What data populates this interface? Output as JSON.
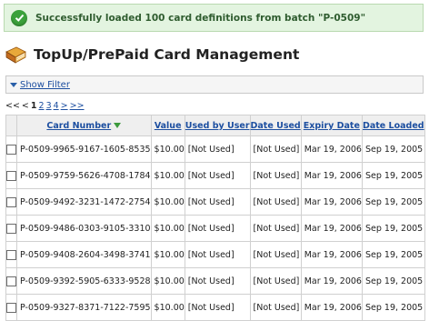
{
  "message": {
    "text": "Successfully loaded 100 card definitions from batch \"P-0509\""
  },
  "page": {
    "title": "TopUp/PrePaid Card Management"
  },
  "filter": {
    "label": "Show Filter"
  },
  "pager": {
    "first": "<<",
    "prev": "<",
    "pages": [
      "1",
      "2",
      "3",
      "4"
    ],
    "current": "1",
    "next": ">",
    "last": ">>"
  },
  "table": {
    "headers": {
      "card_number": "Card Number",
      "value": "Value",
      "used_by": "Used by User",
      "date_used": "Date Used",
      "expiry": "Expiry Date",
      "loaded": "Date Loaded"
    },
    "rows": [
      {
        "card": "P-0509-9965-9167-1605-8535",
        "value": "$10.00",
        "used_by": "[Not Used]",
        "date_used": "[Not Used]",
        "expiry": "Mar 19, 2006",
        "loaded": "Sep 19, 2005"
      },
      {
        "card": "P-0509-9759-5626-4708-1784",
        "value": "$10.00",
        "used_by": "[Not Used]",
        "date_used": "[Not Used]",
        "expiry": "Mar 19, 2006",
        "loaded": "Sep 19, 2005"
      },
      {
        "card": "P-0509-9492-3231-1472-2754",
        "value": "$10.00",
        "used_by": "[Not Used]",
        "date_used": "[Not Used]",
        "expiry": "Mar 19, 2006",
        "loaded": "Sep 19, 2005"
      },
      {
        "card": "P-0509-9486-0303-9105-3310",
        "value": "$10.00",
        "used_by": "[Not Used]",
        "date_used": "[Not Used]",
        "expiry": "Mar 19, 2006",
        "loaded": "Sep 19, 2005"
      },
      {
        "card": "P-0509-9408-2604-3498-3741",
        "value": "$10.00",
        "used_by": "[Not Used]",
        "date_used": "[Not Used]",
        "expiry": "Mar 19, 2006",
        "loaded": "Sep 19, 2005"
      },
      {
        "card": "P-0509-9392-5905-6333-9528",
        "value": "$10.00",
        "used_by": "[Not Used]",
        "date_used": "[Not Used]",
        "expiry": "Mar 19, 2006",
        "loaded": "Sep 19, 2005"
      },
      {
        "card": "P-0509-9327-8371-7122-7595",
        "value": "$10.00",
        "used_by": "[Not Used]",
        "date_used": "[Not Used]",
        "expiry": "Mar 19, 2006",
        "loaded": "Sep 19, 2005"
      }
    ]
  },
  "colors": {
    "success_bg": "#e3f4e0",
    "link": "#1d4fa0",
    "check_green": "#3ba13b"
  },
  "icons": {
    "success": "check-circle-icon",
    "title": "book-icon",
    "filter": "triangle-down-icon",
    "sort": "sort-desc-icon"
  }
}
